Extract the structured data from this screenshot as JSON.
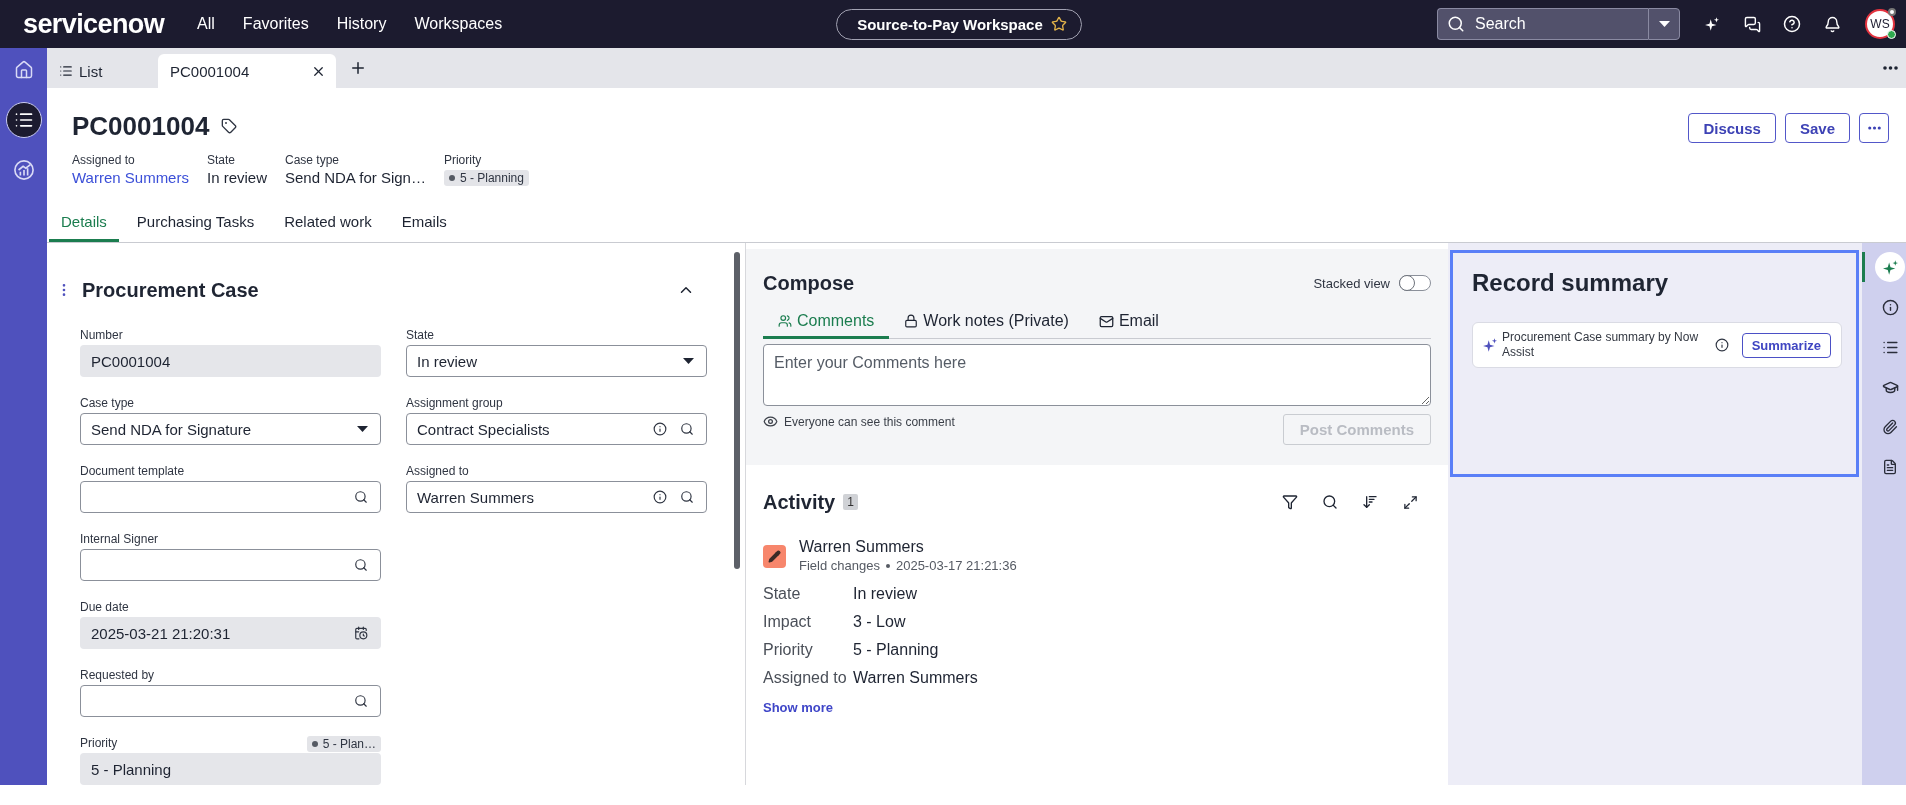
{
  "top_nav": {
    "logo": "servicenow",
    "menu": [
      "All",
      "Favorites",
      "History",
      "Workspaces"
    ],
    "workspace": {
      "label": "Source-to-Pay Workspace",
      "favorite": false
    },
    "search": {
      "placeholder": "Search"
    },
    "avatar": "WS"
  },
  "sidebar": {
    "items": [
      {
        "kind": "home",
        "selected": false
      },
      {
        "kind": "list",
        "selected": true
      },
      {
        "kind": "analytics",
        "selected": false
      }
    ]
  },
  "tab_bar": {
    "tabs": [
      {
        "kind": "list",
        "label": "List",
        "selected": false
      },
      {
        "kind": "record",
        "label": "PC0001004",
        "selected": true
      }
    ]
  },
  "record": {
    "title": "PC0001004",
    "summary_fields": [
      {
        "kind": "link",
        "label": "Assigned to",
        "value": "Warren Summers"
      },
      {
        "kind": "text",
        "label": "State",
        "value": "In review"
      },
      {
        "kind": "text",
        "label": "Case type",
        "value": "Send NDA for Sign…"
      },
      {
        "kind": "badge",
        "label": "Priority",
        "value": "5 - Planning"
      }
    ],
    "actions": [
      "Discuss",
      "Save"
    ]
  },
  "record_tabs": [
    {
      "label": "Details",
      "selected": true
    },
    {
      "label": "Purchasing Tasks",
      "selected": false
    },
    {
      "label": "Related work",
      "selected": false
    },
    {
      "label": "Emails",
      "selected": false
    }
  ],
  "form": {
    "title": "Procurement Case",
    "expanded": true,
    "columns": [
      {
        "fields": [
          {
            "kind": "readonly",
            "label": "Number",
            "value": "PC0001004"
          },
          {
            "kind": "select",
            "label": "Case type",
            "value": "Send NDA for Signature"
          },
          {
            "kind": "reference",
            "label": "Document template"
          },
          {
            "kind": "reference",
            "label": "Internal Signer"
          },
          {
            "kind": "date",
            "label": "Due date",
            "value": "2025-03-21 21:20:31"
          },
          {
            "kind": "reference",
            "label": "Requested by"
          },
          {
            "kind": "readonly",
            "label": "Priority",
            "value": "5 - Planning",
            "badge": "5 - Plan…"
          }
        ]
      },
      {
        "fields": [
          {
            "kind": "select",
            "label": "State",
            "value": "In review"
          },
          {
            "kind": "reference",
            "label": "Assignment group",
            "value": "Contract Specialists"
          },
          {
            "kind": "reference",
            "label": "Assigned to",
            "value": "Warren Summers"
          }
        ]
      }
    ]
  },
  "compose": {
    "title": "Compose",
    "stacked_view": {
      "label": "Stacked view",
      "on": false
    },
    "tabs": [
      {
        "kind": "comments",
        "label": "Comments",
        "selected": true
      },
      {
        "kind": "work_notes",
        "label": "Work notes (Private)",
        "selected": false
      },
      {
        "kind": "email",
        "label": "Email",
        "selected": false
      }
    ],
    "comment_field": {
      "placeholder": "Enter your Comments here"
    },
    "visibility_note": "Everyone can see this comment",
    "post_button": {
      "label": "Post Comments",
      "disabled": true
    }
  },
  "activity": {
    "title": "Activity",
    "count": "1",
    "entries": [
      {
        "author": "Warren Summers",
        "type": "Field changes",
        "timestamp": "2025-03-17 21:21:36",
        "changes": [
          {
            "field": "State",
            "value": "In review"
          },
          {
            "field": "Impact",
            "value": "3 - Low"
          },
          {
            "field": "Priority",
            "value": "5 - Planning"
          },
          {
            "field": "Assigned to",
            "value": "Warren Summers"
          }
        ],
        "show_more": "Show more"
      }
    ]
  },
  "record_summary": {
    "title": "Record summary",
    "card": {
      "text": "Procurement Case summary by Now Assist",
      "button": "Summarize"
    }
  },
  "utility_rail": {
    "items": [
      {
        "kind": "now_assist",
        "selected": true
      },
      {
        "kind": "info",
        "selected": false
      },
      {
        "kind": "list",
        "selected": false
      },
      {
        "kind": "learning",
        "selected": false
      },
      {
        "kind": "attachments",
        "selected": false
      },
      {
        "kind": "document",
        "selected": false
      }
    ]
  }
}
